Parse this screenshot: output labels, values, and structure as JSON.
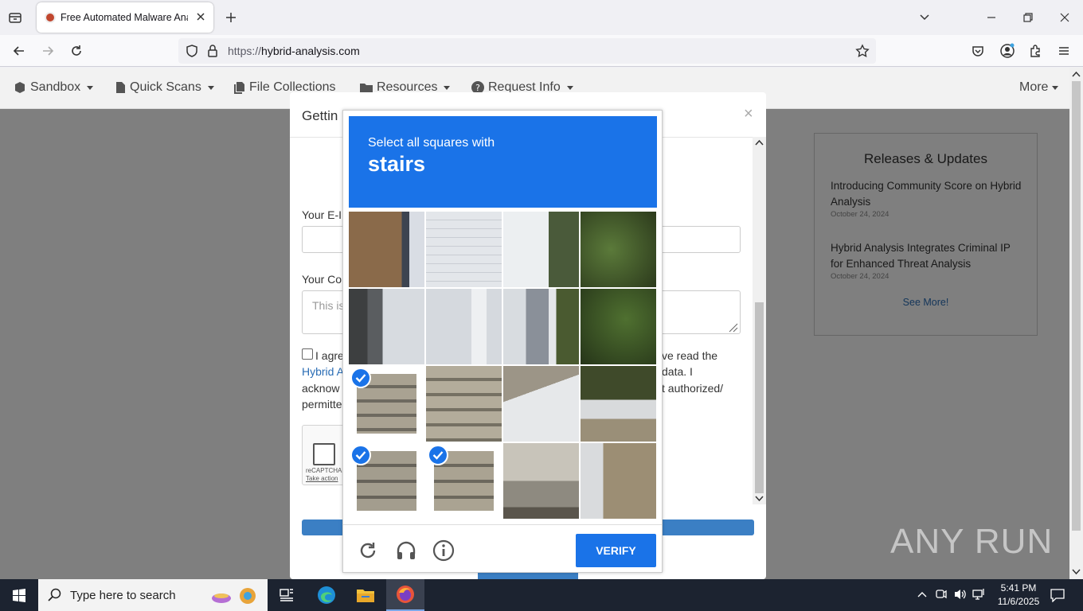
{
  "browser": {
    "tab_title": "Free Automated Malware Analy",
    "url_prefix": "https://",
    "url_domain": "hybrid-analysis.com"
  },
  "site_nav": {
    "items": [
      {
        "label": "Sandbox",
        "icon": "cube-icon"
      },
      {
        "label": "Quick Scans",
        "icon": "file-icon"
      },
      {
        "label": "File Collections",
        "icon": "files-icon"
      },
      {
        "label": "Resources",
        "icon": "folder-icon"
      },
      {
        "label": "Request Info",
        "icon": "question-icon"
      }
    ],
    "more": "More"
  },
  "releases": {
    "title": "Releases & Updates",
    "items": [
      {
        "title": "Introducing Community Score on Hybrid Analysis",
        "date": "October 24, 2024"
      },
      {
        "title": "Hybrid Analysis Integrates Criminal IP for Enhanced Threat Analysis",
        "date": "October 24, 2024"
      }
    ],
    "see_more": "See More!"
  },
  "modal": {
    "title": "Gettin",
    "close": "×",
    "email_label": "Your E-I",
    "comment_label": "Your Co",
    "comment_placeholder": "This is",
    "agree_left": [
      "I agre",
      "Hybrid A",
      "acknow",
      "permitte"
    ],
    "agree_right": [
      "ve read the",
      "data. I",
      "t authorized/"
    ],
    "recaptcha_label": "reCAPTCHA",
    "recaptcha_link": "Take action"
  },
  "captcha": {
    "instruction": "Select all squares with",
    "target": "stairs",
    "verify_label": "VERIFY",
    "selected_tiles": [
      8,
      12,
      13
    ]
  },
  "watermark": "ANY RUN",
  "taskbar": {
    "search_placeholder": "Type here to search",
    "time": "5:41 PM",
    "date": "11/6/2025"
  }
}
